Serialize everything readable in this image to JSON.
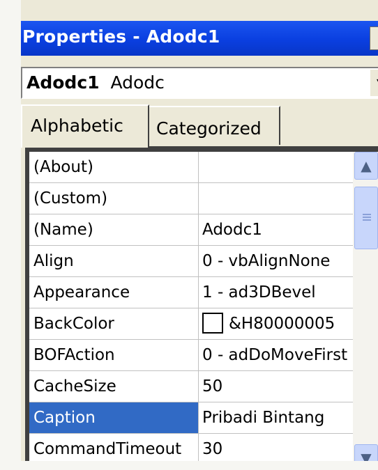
{
  "window": {
    "title": "Properties - Adodc1",
    "close_glyph": "x",
    "title_bar_color": "#0a3fe0"
  },
  "object_selector": {
    "object_name": "Adodc1",
    "object_type": "Adodc",
    "dropdown_icon": "chevron-down-icon"
  },
  "tabs": [
    {
      "label": "Alphabetic",
      "active": true
    },
    {
      "label": "Categorized",
      "active": false
    }
  ],
  "properties": [
    {
      "name": "(About)",
      "value": ""
    },
    {
      "name": "(Custom)",
      "value": ""
    },
    {
      "name": "(Name)",
      "value": "Adodc1"
    },
    {
      "name": "Align",
      "value": "0 - vbAlignNone"
    },
    {
      "name": "Appearance",
      "value": "1 - ad3DBevel"
    },
    {
      "name": "BackColor",
      "value": "&H80000005"
    },
    {
      "name": "BOFAction",
      "value": "0 - adDoMoveFirst"
    },
    {
      "name": "CacheSize",
      "value": "50"
    },
    {
      "name": "Caption",
      "value": "Pribadi Bintang"
    },
    {
      "name": "CommandTimeout",
      "value": "30"
    }
  ],
  "selected_property": "Caption",
  "selection_color": "#316ac5",
  "scrollbar": {
    "up_icon": "scroll-up-arrow-icon",
    "down_icon": "scroll-down-arrow-icon",
    "position": 0.1
  }
}
